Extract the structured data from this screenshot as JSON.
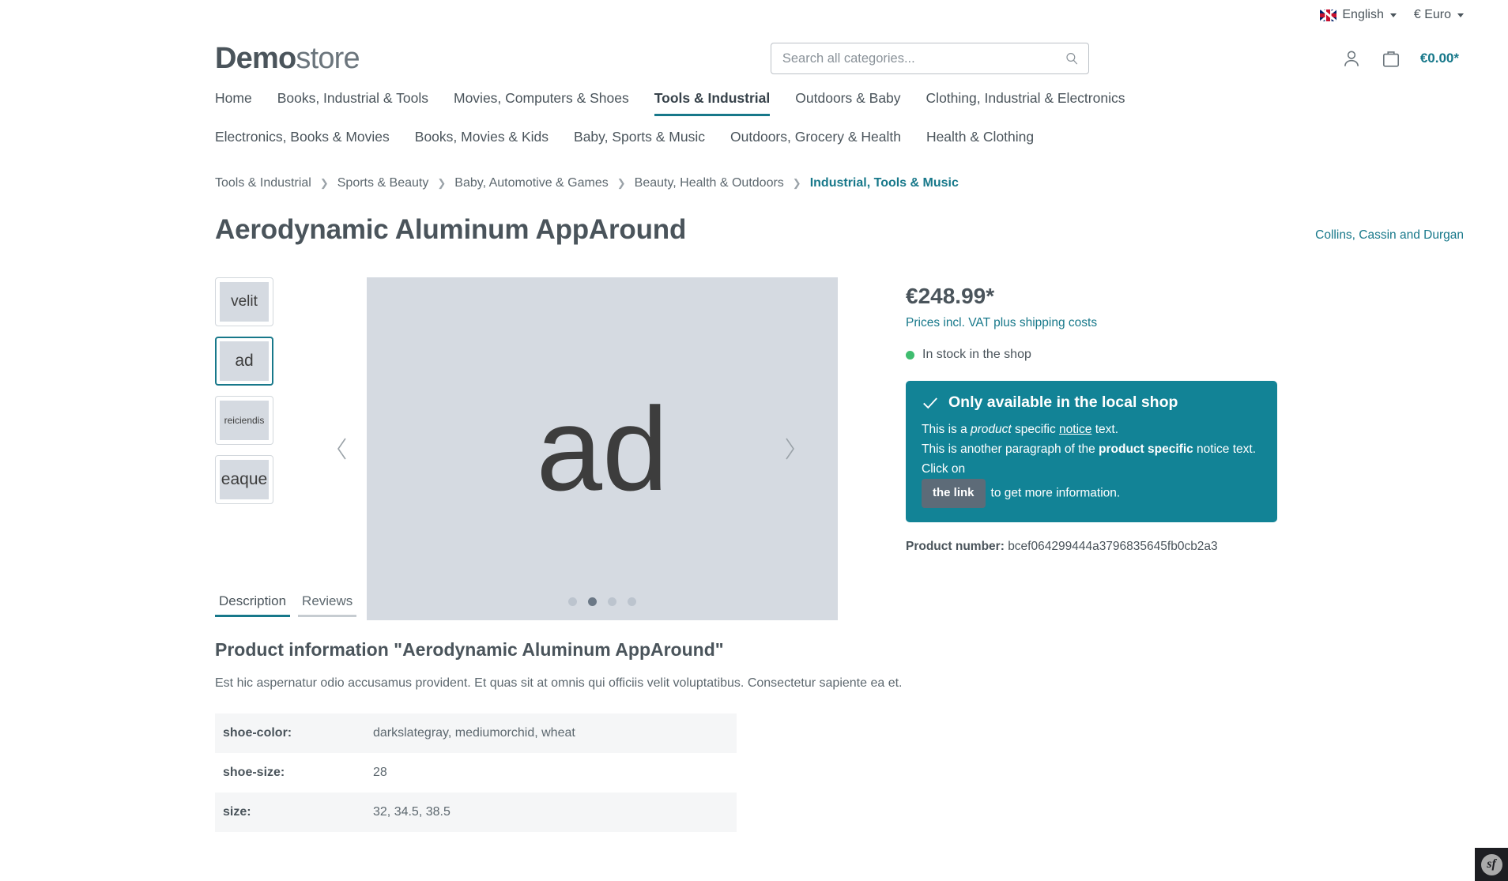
{
  "topbar": {
    "language": "English",
    "currency": "€ Euro",
    "flag_icon": "uk-flag-icon"
  },
  "header": {
    "logo_bold": "Demo",
    "logo_light": "store",
    "search_placeholder": "Search all categories...",
    "search_value": "",
    "cart_total": "€0.00*"
  },
  "nav": {
    "row1": [
      {
        "label": "Home",
        "active": false
      },
      {
        "label": "Books, Industrial & Tools",
        "active": false
      },
      {
        "label": "Movies, Computers & Shoes",
        "active": false
      },
      {
        "label": "Tools & Industrial",
        "active": true
      },
      {
        "label": "Outdoors & Baby",
        "active": false
      },
      {
        "label": "Clothing, Industrial & Electronics",
        "active": false
      }
    ],
    "row2": [
      {
        "label": "Electronics, Books & Movies",
        "active": false
      },
      {
        "label": "Books, Movies & Kids",
        "active": false
      },
      {
        "label": "Baby, Sports & Music",
        "active": false
      },
      {
        "label": "Outdoors, Grocery & Health",
        "active": false
      },
      {
        "label": "Health & Clothing",
        "active": false
      }
    ]
  },
  "breadcrumb": [
    "Tools & Industrial",
    "Sports & Beauty",
    "Baby, Automotive & Games",
    "Beauty, Health & Outdoors",
    "Industrial, Tools & Music"
  ],
  "product": {
    "title": "Aerodynamic Aluminum AppAround",
    "manufacturer": "Collins, Cassin and Durgan",
    "price": "€248.99*",
    "vat_note": "Prices incl. VAT plus shipping costs",
    "stock_label": "In stock in the shop",
    "product_number_label": "Product number:",
    "product_number": "bcef064299444a3796835645fb0cb2a3"
  },
  "gallery": {
    "thumbnails": [
      {
        "label": "velit",
        "active": false
      },
      {
        "label": "ad",
        "active": true
      },
      {
        "label": "reiciendis",
        "active": false
      },
      {
        "label": "eaque",
        "active": false
      }
    ],
    "main_image_label": "ad",
    "dots_count": 4,
    "active_dot_index": 1,
    "prev_icon": "chevron-left-icon",
    "next_icon": "chevron-right-icon"
  },
  "notice": {
    "heading": "Only available in the local shop",
    "check_icon": "check-icon",
    "line1_a": "This is a ",
    "line1_em": "product",
    "line1_b": " specific ",
    "line1_link": "notice",
    "line1_c": " text.",
    "line2_a": "This is another paragraph of the ",
    "line2_strong": "product specific",
    "line2_b": " notice text. Click on",
    "link_button": "the link",
    "line3": "to get more information."
  },
  "tabs": [
    {
      "label": "Description",
      "active": true
    },
    {
      "label": "Reviews",
      "active": false
    }
  ],
  "description": {
    "heading": "Product information \"Aerodynamic Aluminum AppAround\"",
    "text": "Est hic aspernatur odio accusamus provident. Et quas sit at omnis qui officiis velit voluptatibus. Consectetur sapiente ea et.",
    "properties": [
      {
        "key": "shoe-color:",
        "value": "darkslategray, mediumorchid, wheat"
      },
      {
        "key": "shoe-size:",
        "value": "28"
      },
      {
        "key": "size:",
        "value": "32, 34.5, 38.5"
      }
    ]
  },
  "colors": {
    "teal": "#17788a",
    "notice_bg": "#128396",
    "text": "#4a545b",
    "stock_green": "#3fbd6f",
    "placeholder_bg": "#d5dae1"
  },
  "debug_toolbar": {
    "label": "sf"
  }
}
